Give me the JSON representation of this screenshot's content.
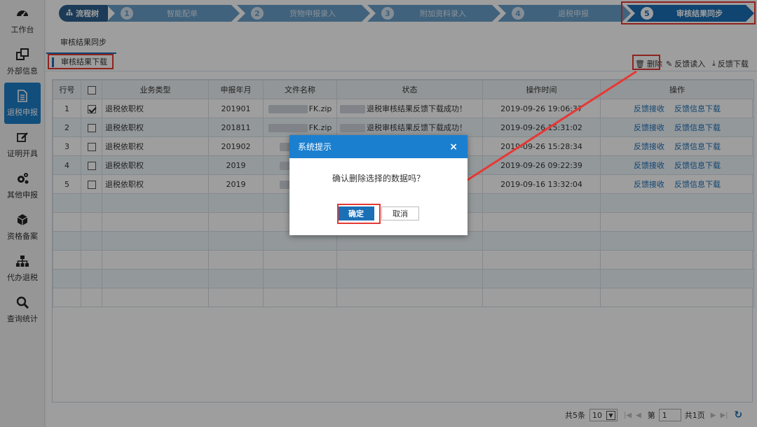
{
  "sidebar": {
    "items": [
      {
        "label": "工作台",
        "icon": "dashboard-icon",
        "active": false
      },
      {
        "label": "外部信息",
        "icon": "windows-icon",
        "active": false
      },
      {
        "label": "退税申报",
        "icon": "document-icon",
        "active": true
      },
      {
        "label": "证明开具",
        "icon": "edit-icon",
        "active": false
      },
      {
        "label": "其他申报",
        "icon": "gears-icon",
        "active": false
      },
      {
        "label": "资格备案",
        "icon": "box-icon",
        "active": false
      },
      {
        "label": "代办退税",
        "icon": "sitemap-icon",
        "active": false
      },
      {
        "label": "查询统计",
        "icon": "search-icon",
        "active": false
      }
    ]
  },
  "steps": {
    "tree_label": "流程树",
    "items": [
      {
        "num": "1",
        "label": "智能配单"
      },
      {
        "num": "2",
        "label": "货物申报录入"
      },
      {
        "num": "3",
        "label": "附加资料录入"
      },
      {
        "num": "4",
        "label": "退税申报"
      },
      {
        "num": "5",
        "label": "审核结果同步"
      }
    ]
  },
  "tab": {
    "label": "审核结果同步"
  },
  "toolbar": {
    "section_title": "审核结果下载",
    "delete_label": "删除",
    "feedback_read_label": "反馈读入",
    "feedback_download_label": "反馈下载"
  },
  "table": {
    "headers": [
      "行号",
      "",
      "业务类型",
      "申报年月",
      "文件名称",
      "状态",
      "操作时间",
      "操作"
    ],
    "rows": [
      {
        "no": "1",
        "checked": true,
        "type": "退税依职权",
        "month": "201901",
        "file": "FK.zip",
        "status": "退税审核结果反馈下载成功！",
        "time": "2019-09-26 19:06:37"
      },
      {
        "no": "2",
        "checked": false,
        "type": "退税依职权",
        "month": "201811",
        "file": "FK.zip",
        "status": "退税审核结果反馈下载成功！",
        "time": "2019-09-26 15:31:02"
      },
      {
        "no": "3",
        "checked": false,
        "type": "退税依职权",
        "month": "201902",
        "file": "",
        "status": "功！",
        "time": "2019-09-26 15:28:34"
      },
      {
        "no": "4",
        "checked": false,
        "type": "退税依职权",
        "month": "2019",
        "file": "",
        "status": "功！",
        "time": "2019-09-26 09:22:39"
      },
      {
        "no": "5",
        "checked": false,
        "type": "退税依职权",
        "month": "2019",
        "file": "",
        "status": "功！",
        "time": "2019-09-16 13:32:04"
      }
    ],
    "action_receive": "反馈接收",
    "action_download": "反馈信息下载"
  },
  "pager": {
    "total": "共5条",
    "page_size": "10",
    "page_prefix": "第",
    "page_value": "1",
    "page_total": "共1页"
  },
  "dialog": {
    "title": "系统提示",
    "close": "×",
    "message": "确认删除选择的数据吗？",
    "ok_label": "确定",
    "cancel_label": "取消"
  },
  "colors": {
    "accent": "#1b6fb7",
    "highlight": "#e53935"
  }
}
